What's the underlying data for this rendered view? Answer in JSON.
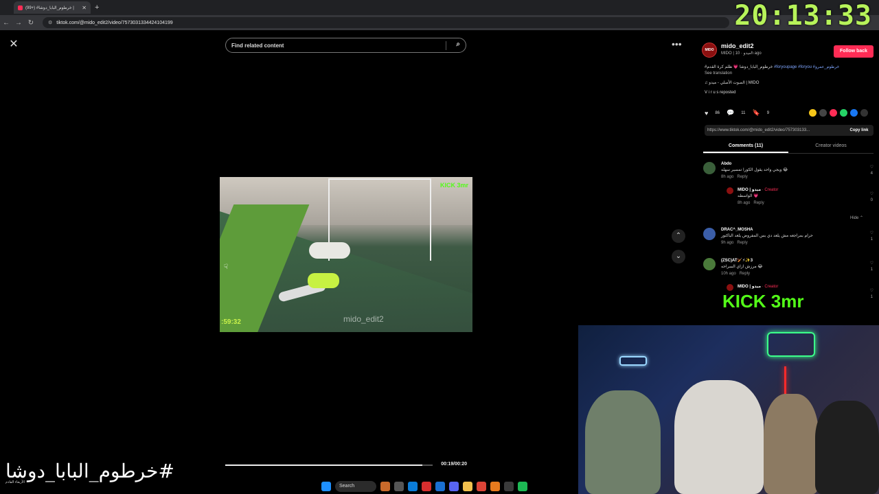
{
  "browser": {
    "tab_title": "(99+) #خرطوم_البابا_دوشا |",
    "url": "tiktok.com/@mido_edit2/video/7573031334424104199"
  },
  "clock": "20:13:33",
  "viewer": {
    "search_placeholder": "Find related content",
    "video": {
      "timer_overlay": ":59:32",
      "watermark": "mido_edit2",
      "kick_badge": "KICK 3mr",
      "time": "00:19/00:20",
      "progress": 0.95
    }
  },
  "panel": {
    "username": "mido_edit2",
    "subline": "MIDO | ميدو · 10h ago",
    "follow_label": "Follow back",
    "caption_ar": "#خرطوم_البابا_دوشا 💗 ظلم كرة القدم",
    "caption_tags": "#foryoupage #foryou #خرطوم_عمرو",
    "see_translation": "See translation",
    "music": "♫ الصوت الأصلي - ميدو | MIDO",
    "reposted": "V i r u s  reposted",
    "likes": "86",
    "comments": "11",
    "saves": "9",
    "link": "https://www.tiktok.com/@mido_edit2/video/757303133...",
    "copy_link": "Copy link",
    "tab_comments": "Comments (11)",
    "tab_creator": "Creator videos",
    "hide": "Hide ⌃"
  },
  "comments": [
    {
      "name": "Abdo",
      "text": "ويجي واحد يقول الكورا تمسير سهله 😂",
      "time": "8h ago",
      "reply": "Reply",
      "likes": "4"
    },
    {
      "name": "DRAC^_MOSHA",
      "text": "حرام بمراجعه مش يلعد دي بس المفروض يلعد الباكتور",
      "time": "9h ago",
      "reply": "Reply",
      "likes": "1"
    },
    {
      "name": "(ZSC)AT🏏⚡✨3",
      "text": "مرزش ازاي السراحه 😂",
      "time": "10h ago",
      "reply": "Reply",
      "likes": "1"
    }
  ],
  "replies": [
    {
      "name": "MIDO | ميدو",
      "creator": " · Creator",
      "text": "الواسطه 💗",
      "time": "8h ago",
      "reply": "Reply",
      "likes": "0"
    },
    {
      "name": "MIDO | ميدو",
      "creator": " · Creator",
      "text": "",
      "time": "",
      "reply": "",
      "likes": "1"
    }
  ],
  "overlay": {
    "kick_big": "KICK 3mr",
    "hashtag": "#خرطوم_البابا_دوشا"
  },
  "taskbar": {
    "weather_line1": "الأربعاء القادم",
    "weather_line2": "",
    "search": "Search"
  },
  "colors": {
    "tiktok_red": "#fe2c55",
    "kick_green": "#53fc18",
    "clock_green": "#b7f35a"
  }
}
